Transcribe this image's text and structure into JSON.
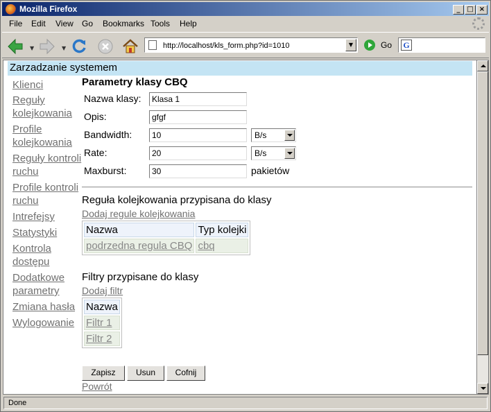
{
  "window": {
    "title": "Mozilla Firefox"
  },
  "menu": [
    "File",
    "Edit",
    "View",
    "Go",
    "Bookmarks",
    "Tools",
    "Help"
  ],
  "toolbar": {
    "url": "http://localhost/kls_form.php?id=1010",
    "go_label": "Go",
    "search_placeholder": ""
  },
  "page": {
    "header": "Zarzadzanie systemem",
    "sidebar": [
      "Klienci",
      "Reguły kolejkowania",
      "Profile kolejkowania",
      "Reguły kontroli ruchu",
      "Profile kontroli ruchu",
      "Intrefejsy",
      "Statystyki",
      "Kontrola dostępu",
      "Dodatkowe parametry",
      "Zmiana hasła",
      "Wylogowanie"
    ],
    "form": {
      "title": "Parametry klasy CBQ",
      "name_label": "Nazwa klasy:",
      "name_value": "Klasa 1",
      "desc_label": "Opis:",
      "desc_value": "gfgf",
      "bandwidth_label": "Bandwidth:",
      "bandwidth_value": "10",
      "bandwidth_unit": "B/s",
      "rate_label": "Rate:",
      "rate_value": "20",
      "rate_unit": "B/s",
      "maxburst_label": "Maxburst:",
      "maxburst_value": "30",
      "maxburst_unit": "pakietów"
    },
    "rule_section": {
      "title": "Reguła kolejkowania przypisana do klasy",
      "add_link": "Dodaj regule kolejkowania",
      "headers": [
        "Nazwa",
        "Typ kolejki"
      ],
      "rows": [
        [
          "podrzedna regula CBQ",
          "cbq"
        ]
      ]
    },
    "filter_section": {
      "title": "Filtry przypisane do klasy",
      "add_link": "Dodaj filtr",
      "headers": [
        "Nazwa"
      ],
      "rows": [
        "Filtr 1",
        "Filtr 2"
      ]
    },
    "buttons": {
      "save": "Zapisz",
      "delete": "Usun",
      "undo": "Cofnij"
    },
    "back_link": "Powrót"
  },
  "status": {
    "text": "Done"
  }
}
